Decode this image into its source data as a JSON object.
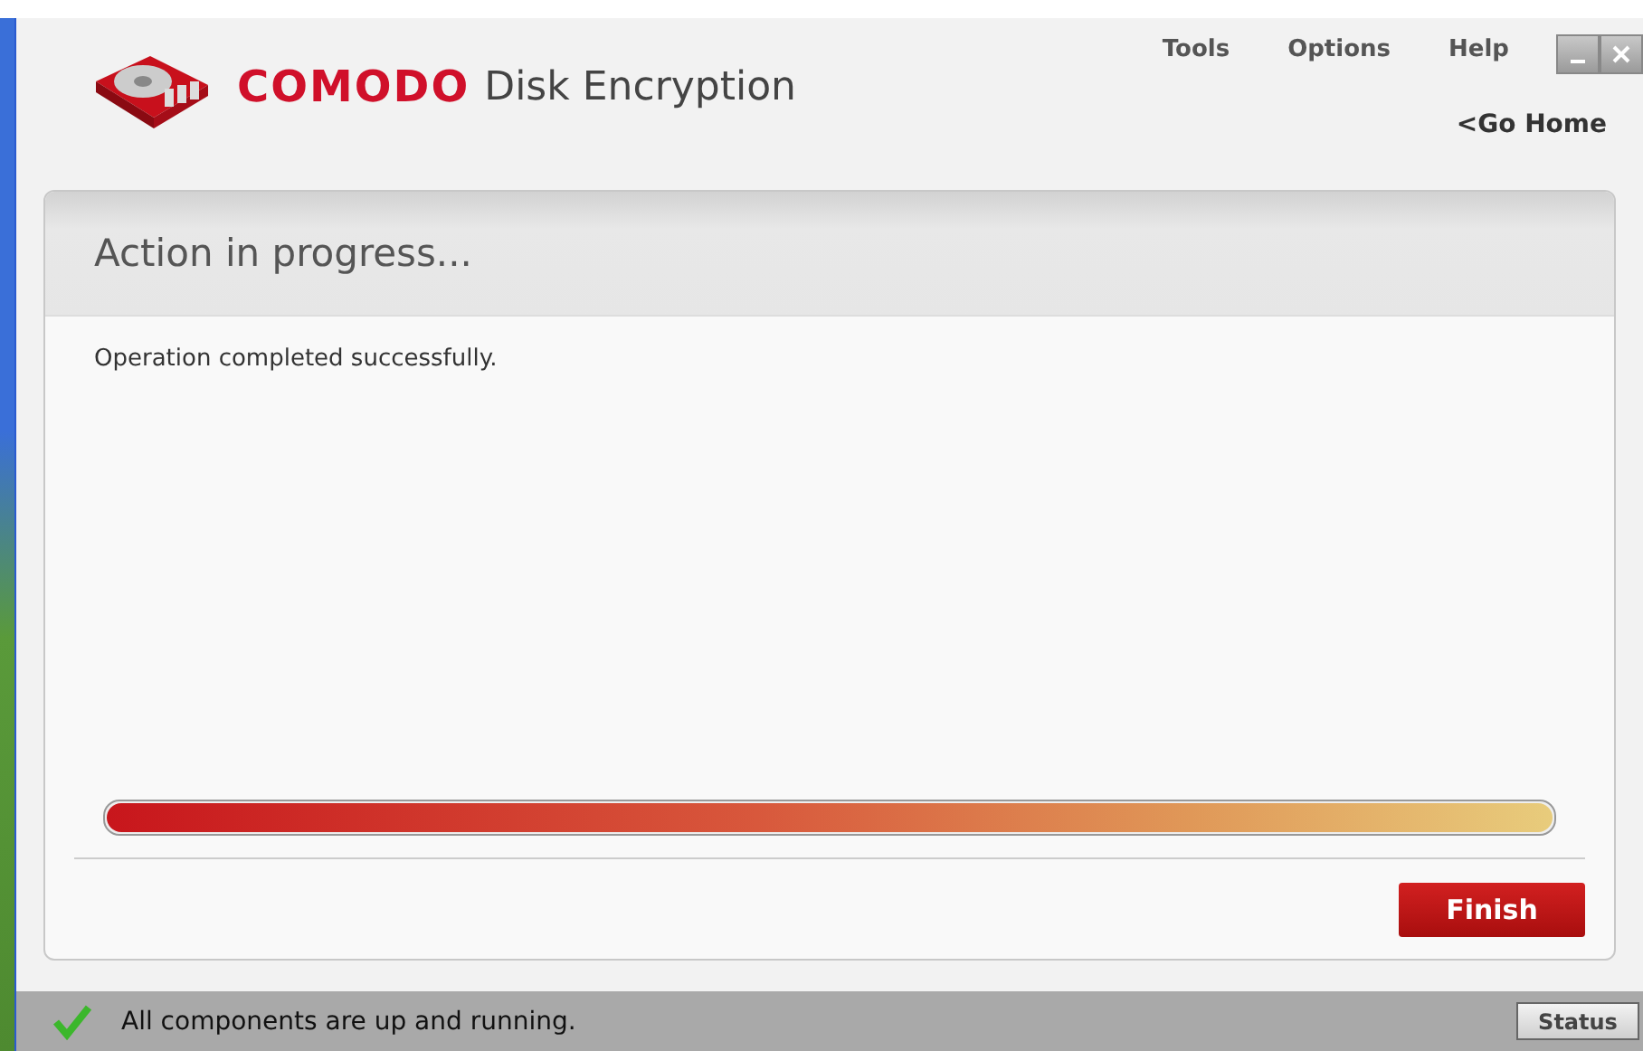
{
  "app": {
    "brand": "COMODO",
    "product": "Disk Encryption"
  },
  "menu": [
    "Tools",
    "Options",
    "Help"
  ],
  "nav": {
    "back_link": "<Go Home"
  },
  "panel": {
    "title": "Action in progress...",
    "message": "Operation completed successfully.",
    "progress": {
      "level": 1.0
    },
    "button": "Finish"
  },
  "status_bar": {
    "ok": true,
    "text": "All components are up and running.",
    "button": "Status"
  }
}
